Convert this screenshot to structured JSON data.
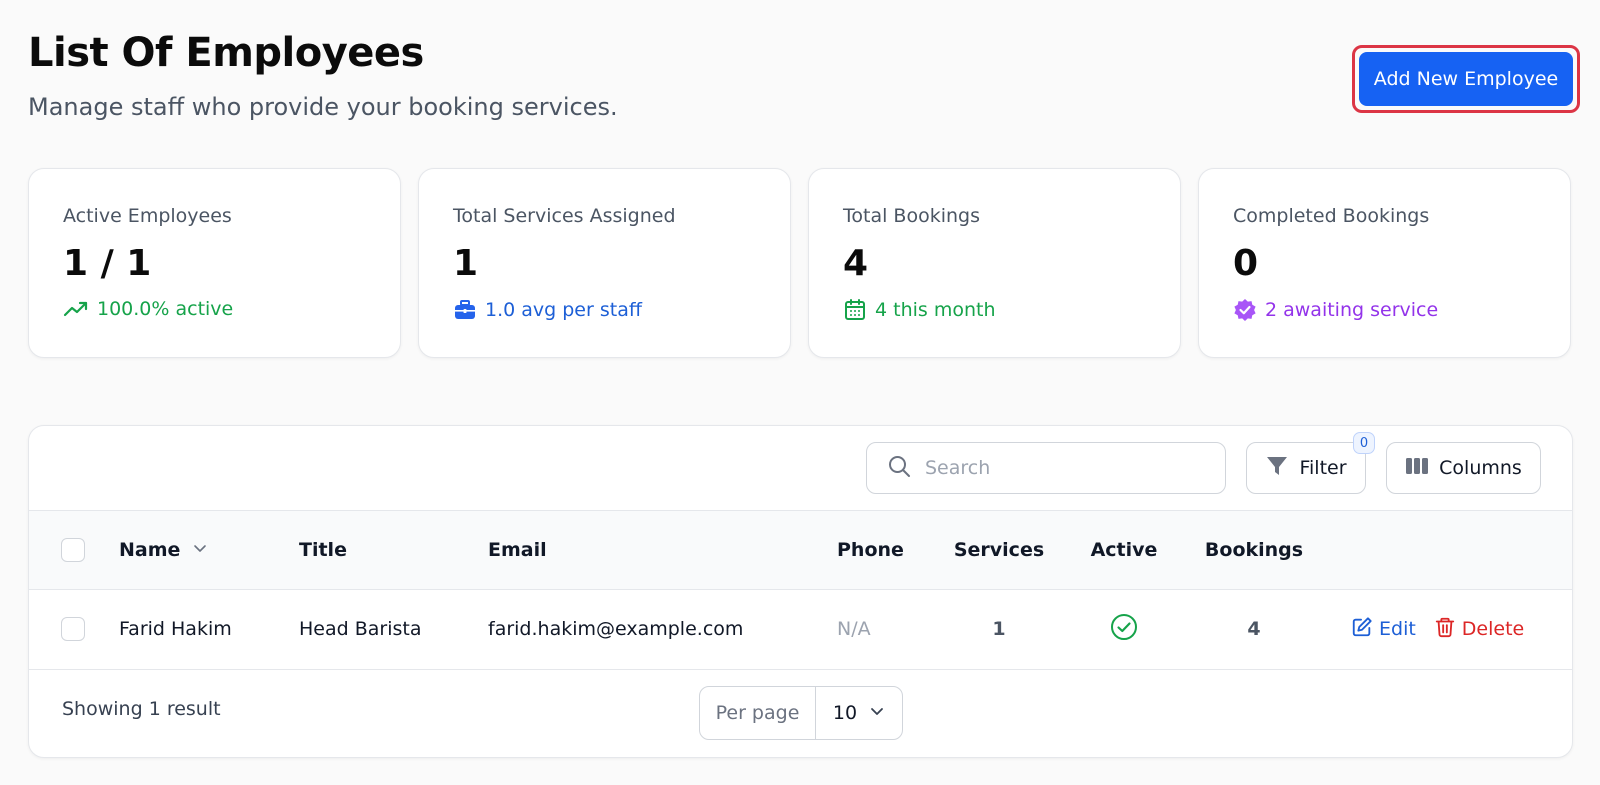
{
  "header": {
    "title": "List Of Employees",
    "subtitle": "Manage staff who provide your booking services.",
    "add_button_label": "Add New Employee"
  },
  "stats": [
    {
      "label": "Active Employees",
      "value": "1 / 1",
      "sub": "100.0% active",
      "icon": "trending-up-icon",
      "color": "#16a34a"
    },
    {
      "label": "Total Services Assigned",
      "value": "1",
      "sub": "1.0 avg per staff",
      "icon": "briefcase-icon",
      "color": "#1d5fd6"
    },
    {
      "label": "Total Bookings",
      "value": "4",
      "sub": "4 this month",
      "icon": "calendar-icon",
      "color": "#16a34a"
    },
    {
      "label": "Completed Bookings",
      "value": "0",
      "sub": "2 awaiting service",
      "icon": "badge-check-icon",
      "color": "#9333ea"
    }
  ],
  "toolbar": {
    "search_placeholder": "Search",
    "filter_label": "Filter",
    "filter_count": "0",
    "columns_label": "Columns"
  },
  "table": {
    "columns": [
      "Name",
      "Title",
      "Email",
      "Phone",
      "Services",
      "Active",
      "Bookings"
    ],
    "sorted_column": "Name",
    "rows": [
      {
        "name": "Farid Hakim",
        "title": "Head Barista",
        "email": "farid.hakim@example.com",
        "phone": "N/A",
        "services": "1",
        "active": true,
        "bookings": "4",
        "edit_label": "Edit",
        "delete_label": "Delete"
      }
    ]
  },
  "footer": {
    "showing_text": "Showing 1 result",
    "per_page_label": "Per page",
    "per_page_value": "10"
  },
  "colors": {
    "primary": "#1662f3",
    "highlight_ring": "#dc3545",
    "success": "#16a34a",
    "danger": "#dc2626",
    "purple": "#9333ea"
  }
}
